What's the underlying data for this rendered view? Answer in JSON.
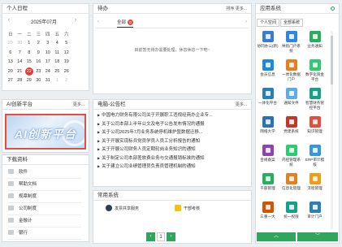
{
  "calendar": {
    "title": "个人日程",
    "month_label": "2025年07月",
    "prev_icon": "‹",
    "next_icon": "›",
    "weekdays": [
      "日",
      "一",
      "二",
      "三",
      "四",
      "五",
      "六"
    ],
    "rows": [
      [
        "29",
        "30",
        "1",
        "2",
        "3",
        "4",
        "5"
      ],
      [
        "6",
        "7",
        "8",
        "9",
        "10",
        "11",
        "12"
      ],
      [
        "13",
        "14",
        "15",
        "16",
        "17",
        "18",
        "19"
      ],
      [
        "20",
        "21",
        "22",
        "23",
        "24",
        "25",
        "26"
      ],
      [
        "27",
        "28",
        "29",
        "30",
        "31",
        "1",
        "2"
      ]
    ],
    "today": "22"
  },
  "ai_platform": {
    "title": "AI创新平台",
    "more": "更多...",
    "banner_text": "AI创新平台"
  },
  "downloads": {
    "title": "下载资料",
    "items": [
      "软件",
      "帮助文档",
      "规章制度",
      "公司制度",
      "金融计",
      "银行"
    ]
  },
  "todo": {
    "title": "待办",
    "actions": "排序  更多...",
    "tab_label": "全部",
    "tab_count": "0",
    "empty_text": "目前暂无待办需要处理，休息休息一下吧~"
  },
  "news": {
    "title": "电脑-公告栏",
    "more": "更多...",
    "items": [
      "中国电力财务有限公司关于开展职工违规经商办企业专...",
      "关于公司本部上半年公文及电子公告发布情况的通报",
      "关于公司2025年7月业务系统停机维护暨数据迁移...",
      "关于开展实现标兵党员学员人员工分析报告的通知",
      "关于开展公司财务人员定期轮岗业务知识的通知",
      "关于制定公司本部差旅费业务与交通报销标准的通知",
      "关于建立公司业绩管理员负责员管理机制的通知"
    ]
  },
  "common_systems": {
    "title": "常用系统",
    "items": [
      "发票共享服务",
      "干部考核"
    ],
    "page": "1"
  },
  "apps": {
    "title": "应用系统",
    "tabs": [
      "个人空间",
      "全部系统"
    ],
    "items": [
      {
        "label": "协同办公(新)",
        "color": "#3a7bd5"
      },
      {
        "label": "导航门户系统",
        "color": "#2e86de"
      },
      {
        "label": "业务通知",
        "color": "#27ae60"
      },
      {
        "label": "会员信息",
        "color": "#1e88e5"
      },
      {
        "label": "一体化数据门户",
        "color": "#e67e22"
      },
      {
        "label": "数字化资金平台",
        "color": "#2ecc71"
      },
      {
        "label": "一体化平台",
        "color": "#2980b9"
      },
      {
        "label": "通知文件",
        "color": "#5dade2"
      },
      {
        "label": "智慧财务管控平台",
        "color": "#16a085"
      },
      {
        "label": "网络大学",
        "color": "#2c6fbb"
      },
      {
        "label": "党建系统",
        "color": "#c0392b"
      },
      {
        "label": "知识管理",
        "color": "#e74c3c"
      },
      {
        "label": "合规备案",
        "color": "#8e44ad"
      },
      {
        "label": "内控管理系统",
        "color": "#2ecc71"
      },
      {
        "label": "ERP审计稽核",
        "color": "#3498db"
      },
      {
        "label": "干部管理",
        "color": "#27ae60"
      },
      {
        "label": "信息化管理",
        "color": "#e67e22"
      },
      {
        "label": "流程管理",
        "color": "#f39c12"
      },
      {
        "label": "三重一大",
        "color": "#d35400"
      },
      {
        "label": "统一权限",
        "color": "#16a085"
      },
      {
        "label": "审计门户",
        "color": "#2980b9"
      }
    ]
  }
}
